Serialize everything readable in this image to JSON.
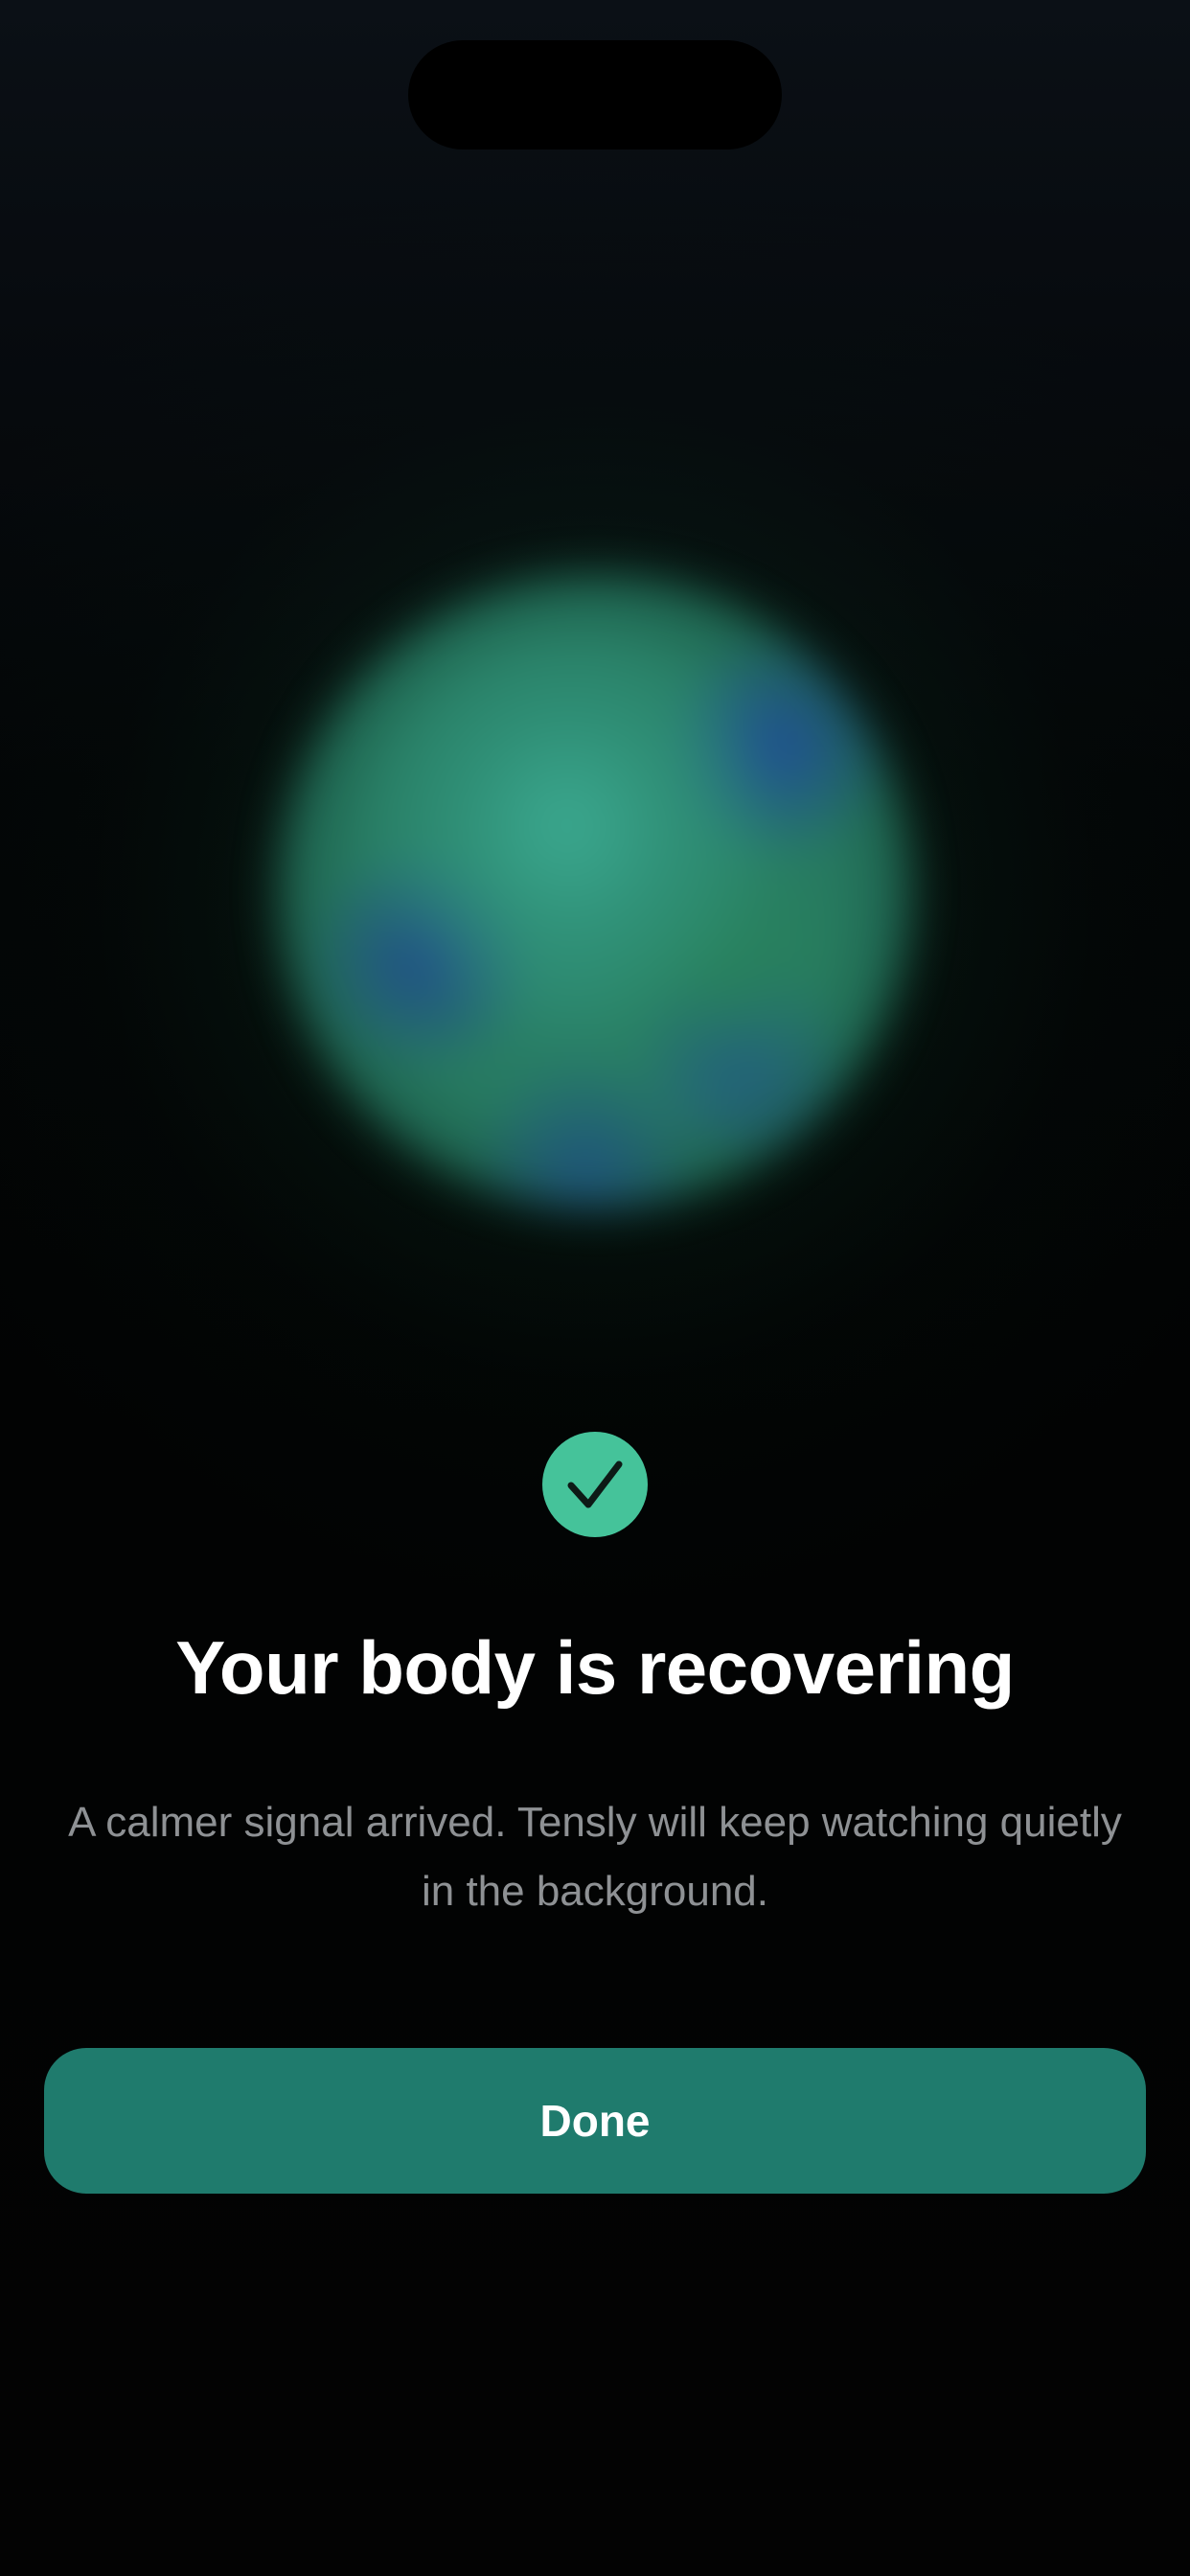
{
  "hero": {
    "orb_icon": "breathing-orb",
    "status_icon": "checkmark-icon"
  },
  "content": {
    "title": "Your body is recovering",
    "subtitle": "A calmer signal arrived. Tensly will keep watching quietly in the background."
  },
  "actions": {
    "done_label": "Done"
  },
  "colors": {
    "accent": "#45c39a",
    "button": "#1f7b6d",
    "background": "#030405",
    "title_text": "#ffffff",
    "subtitle_text": "#8e9194"
  }
}
